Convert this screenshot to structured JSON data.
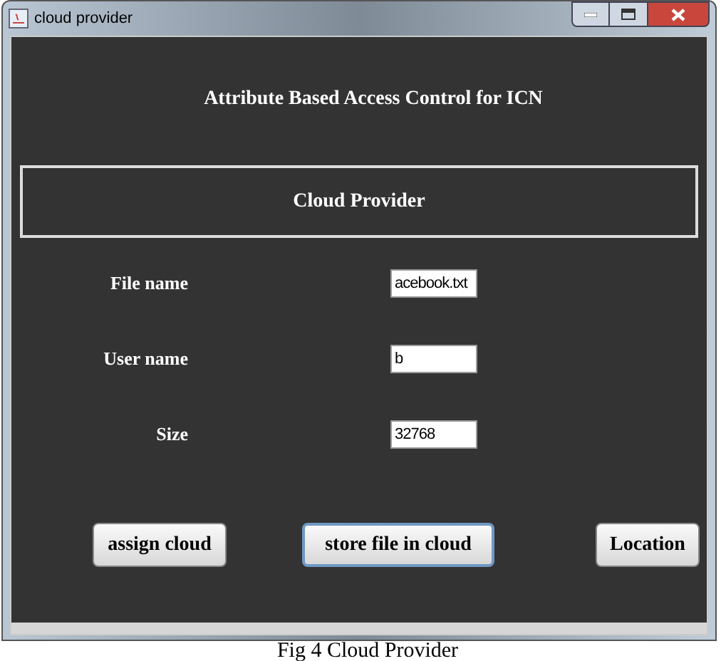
{
  "window": {
    "title": "cloud provider"
  },
  "heading": "Attribute Based Access Control for ICN",
  "panel_title": "Cloud Provider",
  "fields": [
    {
      "label": "File name",
      "value": "acebook.txt"
    },
    {
      "label": "User name",
      "value": "b"
    },
    {
      "label": "Size",
      "value": "32768"
    }
  ],
  "buttons": [
    {
      "label": "assign cloud",
      "focused": false
    },
    {
      "label": "store file in cloud",
      "focused": true
    },
    {
      "label": "Location",
      "focused": false
    }
  ],
  "caption": "Fig 4 Cloud Provider"
}
